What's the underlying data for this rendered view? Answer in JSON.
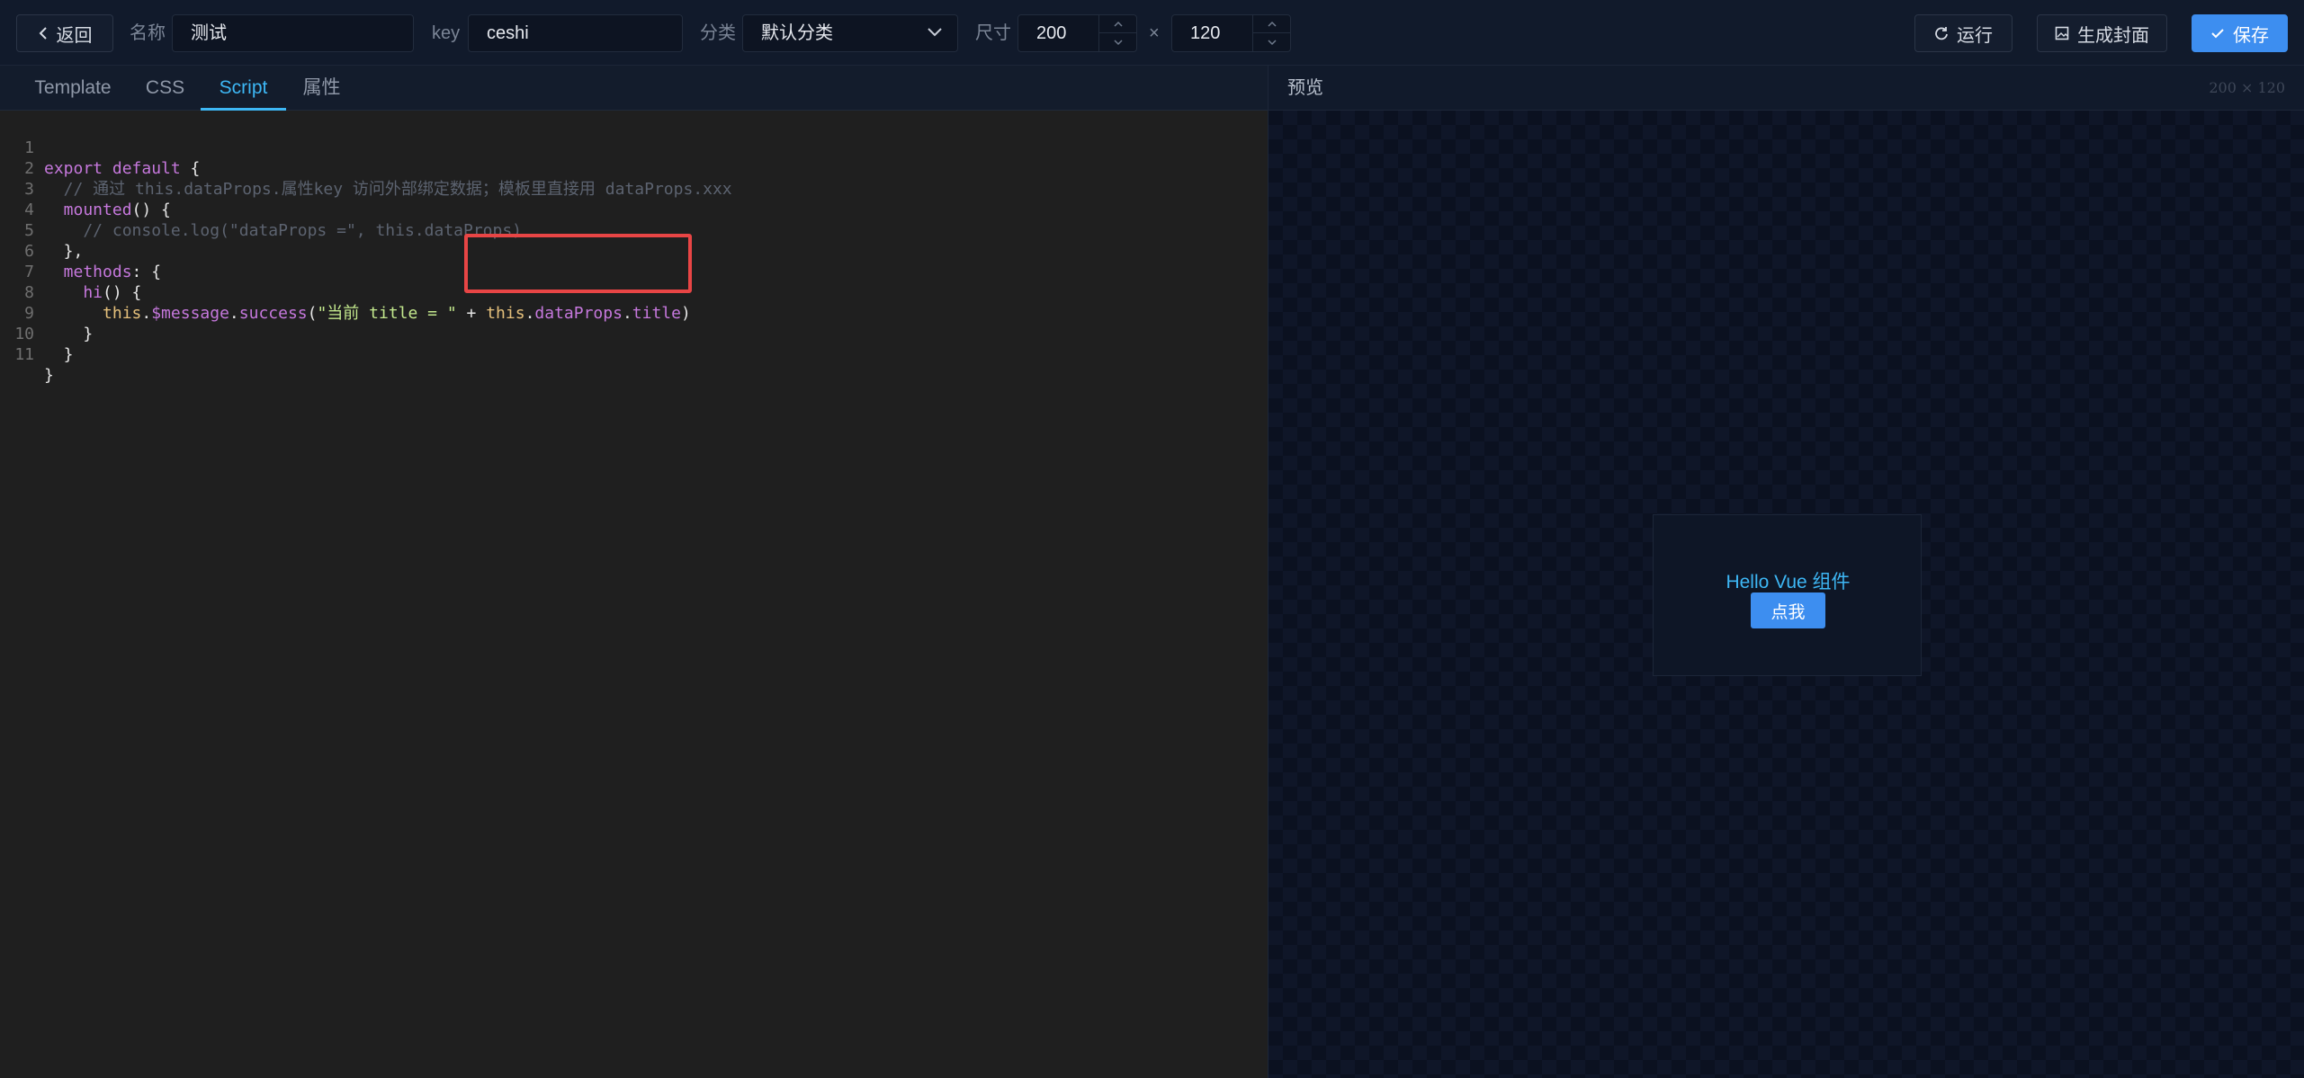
{
  "toolbar": {
    "back_label": "返回",
    "name_label": "名称",
    "name_value": "测试",
    "key_label": "key",
    "key_value": "ceshi",
    "category_label": "分类",
    "category_value": "默认分类",
    "size_label": "尺寸",
    "width_value": "200",
    "times": "×",
    "height_value": "120",
    "run_label": "运行",
    "cover_label": "生成封面",
    "save_label": "保存"
  },
  "tabs": [
    {
      "label": "Template"
    },
    {
      "label": "CSS"
    },
    {
      "label": "Script"
    },
    {
      "label": "属性"
    }
  ],
  "active_tab": "Script",
  "editor": {
    "lines": [
      {
        "n": "1",
        "text": "export default {"
      },
      {
        "n": "2",
        "text": "  // 通过 this.dataProps.属性key 访问外部绑定数据；模板里直接用 dataProps.xxx"
      },
      {
        "n": "3",
        "text": "  mounted() {"
      },
      {
        "n": "4",
        "text": "    // console.log(\"dataProps =\", this.dataProps)"
      },
      {
        "n": "5",
        "text": "  },"
      },
      {
        "n": "6",
        "text": "  methods: {"
      },
      {
        "n": "7",
        "text": "    hi() {"
      },
      {
        "n": "8",
        "text": "      this.$message.success(\"当前 title = \" + this.dataProps.title)"
      },
      {
        "n": "9",
        "text": "    }"
      },
      {
        "n": "10",
        "text": "  }"
      },
      {
        "n": "11",
        "text": "}"
      }
    ]
  },
  "preview": {
    "title": "预览",
    "dims": "200 × 120",
    "card_title": "Hello Vue 组件",
    "card_button": "点我"
  },
  "colors": {
    "accent": "#3db7f5",
    "primary": "#3d8ef0",
    "highlight": "#e84545"
  }
}
